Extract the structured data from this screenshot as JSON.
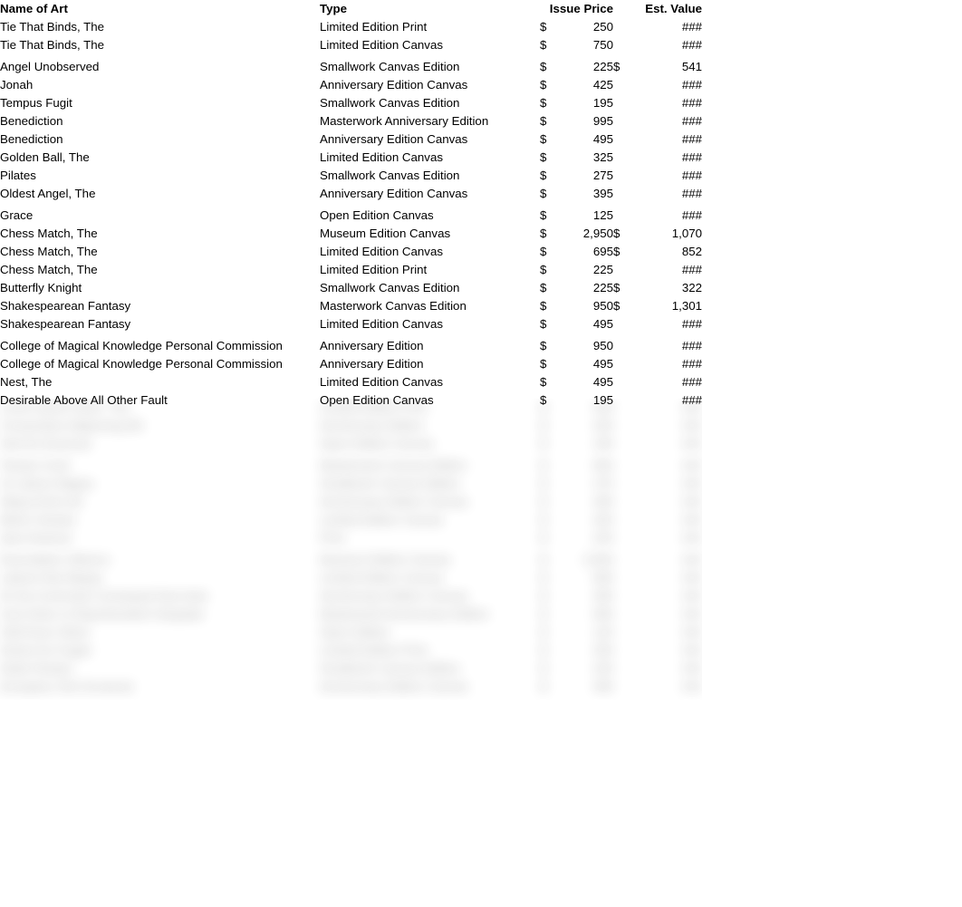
{
  "table": {
    "headers": {
      "name": "Name of Art",
      "type": "Type",
      "issue_price": "Issue Price",
      "est_value": "Est. Value"
    },
    "currency_symbol": "$",
    "hidden_value_marker": "###",
    "rows": [
      {
        "name": "Tie That Binds, The",
        "type": "Limited Edition Print",
        "issue_cur": "$",
        "issue_price": "250",
        "est_cur": "",
        "est_value": "###",
        "gap_above": false
      },
      {
        "name": "Tie That Binds, The",
        "type": "Limited Edition Canvas",
        "issue_cur": "$",
        "issue_price": "750",
        "est_cur": "",
        "est_value": "###",
        "gap_above": false
      },
      {
        "name": "Angel Unobserved",
        "type": "Smallwork Canvas Edition",
        "issue_cur": "$",
        "issue_price": "225",
        "est_cur": "$",
        "est_value": "541",
        "gap_above": true
      },
      {
        "name": "Jonah",
        "type": "Anniversary Edition Canvas",
        "issue_cur": "$",
        "issue_price": "425",
        "est_cur": "",
        "est_value": "###",
        "gap_above": false
      },
      {
        "name": "Tempus Fugit",
        "type": "Smallwork Canvas Edition",
        "issue_cur": "$",
        "issue_price": "195",
        "est_cur": "",
        "est_value": "###",
        "gap_above": false
      },
      {
        "name": "Benediction",
        "type": "Masterwork Anniversary Edition",
        "issue_cur": "$",
        "issue_price": "995",
        "est_cur": "",
        "est_value": "###",
        "gap_above": false
      },
      {
        "name": "Benediction",
        "type": "Anniversary Edition Canvas",
        "issue_cur": "$",
        "issue_price": "495",
        "est_cur": "",
        "est_value": "###",
        "gap_above": false
      },
      {
        "name": "Golden Ball, The",
        "type": "Limited Edition Canvas",
        "issue_cur": "$",
        "issue_price": "325",
        "est_cur": "",
        "est_value": "###",
        "gap_above": false
      },
      {
        "name": "Pilates",
        "type": "Smallwork Canvas Edition",
        "issue_cur": "$",
        "issue_price": "275",
        "est_cur": "",
        "est_value": "###",
        "gap_above": false
      },
      {
        "name": "Oldest Angel, The",
        "type": "Anniversary Edition Canvas",
        "issue_cur": "$",
        "issue_price": "395",
        "est_cur": "",
        "est_value": "###",
        "gap_above": false
      },
      {
        "name": "Grace",
        "type": "Open Edition Canvas",
        "issue_cur": "$",
        "issue_price": "125",
        "est_cur": "",
        "est_value": "###",
        "gap_above": true
      },
      {
        "name": "Chess Match, The",
        "type": "Museum Edition Canvas",
        "issue_cur": "$",
        "issue_price": "2,950",
        "est_cur": "$",
        "est_value": "1,070",
        "gap_above": false
      },
      {
        "name": "Chess Match, The",
        "type": "Limited Edition Canvas",
        "issue_cur": "$",
        "issue_price": "695",
        "est_cur": "$",
        "est_value": "852",
        "gap_above": false
      },
      {
        "name": "Chess Match, The",
        "type": "Limited Edition Print",
        "issue_cur": "$",
        "issue_price": "225",
        "est_cur": "",
        "est_value": "###",
        "gap_above": false
      },
      {
        "name": "Butterfly Knight",
        "type": "Smallwork Canvas Edition",
        "issue_cur": "$",
        "issue_price": "225",
        "est_cur": "$",
        "est_value": "322",
        "gap_above": false
      },
      {
        "name": "Shakespearean Fantasy",
        "type": "Masterwork Canvas Edition",
        "issue_cur": "$",
        "issue_price": "950",
        "est_cur": "$",
        "est_value": "1,301",
        "gap_above": false
      },
      {
        "name": "Shakespearean Fantasy",
        "type": "Limited Edition Canvas",
        "issue_cur": "$",
        "issue_price": "495",
        "est_cur": "",
        "est_value": "###",
        "gap_above": false
      },
      {
        "name": "College of Magical Knowledge Personal Commission",
        "type": "Anniversary Edition",
        "issue_cur": "$",
        "issue_price": "950",
        "est_cur": "",
        "est_value": "###",
        "gap_above": true
      },
      {
        "name": "College of Magical Knowledge Personal Commission",
        "type": "Anniversary Edition",
        "issue_cur": "$",
        "issue_price": "495",
        "est_cur": "",
        "est_value": "###",
        "gap_above": false
      },
      {
        "name": "Nest, The",
        "type": "Limited Edition Canvas",
        "issue_cur": "$",
        "issue_price": "495",
        "est_cur": "",
        "est_value": "###",
        "gap_above": false
      },
      {
        "name": "Desirable Above All Other Fault",
        "type": "Open Edition Canvas",
        "issue_cur": "$",
        "issue_price": "195",
        "est_cur": "",
        "est_value": "###",
        "gap_above": false
      }
    ],
    "obscured_rows": [
      {
        "name": "Lorem Ipsum Dolor, The",
        "type": "Limited Edition Print",
        "issue_cur": "$",
        "issue_price": "250",
        "est_cur": "",
        "est_value": "###",
        "gap_above": false
      },
      {
        "name": "Consectetur Adipiscing Elit",
        "type": "Anniversary Edition",
        "issue_cur": "$",
        "issue_price": "425",
        "est_cur": "",
        "est_value": "###",
        "gap_above": false
      },
      {
        "name": "Sed Do Eiusmod",
        "type": "Open Edition Canvas",
        "issue_cur": "$",
        "issue_price": "195",
        "est_cur": "",
        "est_value": "###",
        "gap_above": false
      },
      {
        "name": "Tempor Incid",
        "type": "Masterwork Canvas Edition",
        "issue_cur": "$",
        "issue_price": "950",
        "est_cur": "",
        "est_value": "###",
        "gap_above": true
      },
      {
        "name": "Ut Labore Magna",
        "type": "Smallwork Canvas Edition",
        "issue_cur": "$",
        "issue_price": "275",
        "est_cur": "",
        "est_value": "###",
        "gap_above": false
      },
      {
        "name": "Aliqua Enim Ad",
        "type": "Anniversary Edition Canvas",
        "issue_cur": "$",
        "issue_price": "495",
        "est_cur": "",
        "est_value": "###",
        "gap_above": false
      },
      {
        "name": "Minim Veniam",
        "type": "Limited Edition Canvas",
        "issue_cur": "$",
        "issue_price": "325",
        "est_cur": "",
        "est_value": "###",
        "gap_above": false
      },
      {
        "name": "Quis Nostrud",
        "type": "Print",
        "issue_cur": "$",
        "issue_price": "225",
        "est_cur": "",
        "est_value": "###",
        "gap_above": false
      },
      {
        "name": "Exercitation Ullamco",
        "type": "Museum Edition Canvas",
        "issue_cur": "$",
        "issue_price": "2,950",
        "est_cur": "",
        "est_value": "###",
        "gap_above": true
      },
      {
        "name": "Laboris Nisi Aliquip",
        "type": "Limited Edition Canvas",
        "issue_cur": "$",
        "issue_price": "695",
        "est_cur": "",
        "est_value": "###",
        "gap_above": false
      },
      {
        "name": "Ex Ea Commodo Consequat Duis Aute",
        "type": "Anniversary Edition Canvas",
        "issue_cur": "$",
        "issue_price": "395",
        "est_cur": "",
        "est_value": "###",
        "gap_above": false
      },
      {
        "name": "Irure Dolor In Reprehenderit Voluptate",
        "type": "Masterwork Anniversary Edition",
        "issue_cur": "$",
        "issue_price": "995",
        "est_cur": "",
        "est_value": "###",
        "gap_above": false
      },
      {
        "name": "Velit Esse Cillum",
        "type": "Open Edition",
        "issue_cur": "$",
        "issue_price": "125",
        "est_cur": "",
        "est_value": "###",
        "gap_above": false
      },
      {
        "name": "Dolore Eu Fugiat",
        "type": "Limited Edition Print",
        "issue_cur": "$",
        "issue_price": "250",
        "est_cur": "",
        "est_value": "###",
        "gap_above": false
      },
      {
        "name": "Nulla Pariatur",
        "type": "Smallwork Canvas Edition",
        "issue_cur": "$",
        "issue_price": "225",
        "est_cur": "",
        "est_value": "###",
        "gap_above": false
      },
      {
        "name": "Excepteur Sint Occaecat",
        "type": "Anniversary Edition Canvas",
        "issue_cur": "$",
        "issue_price": "495",
        "est_cur": "",
        "est_value": "###",
        "gap_above": false
      }
    ]
  }
}
